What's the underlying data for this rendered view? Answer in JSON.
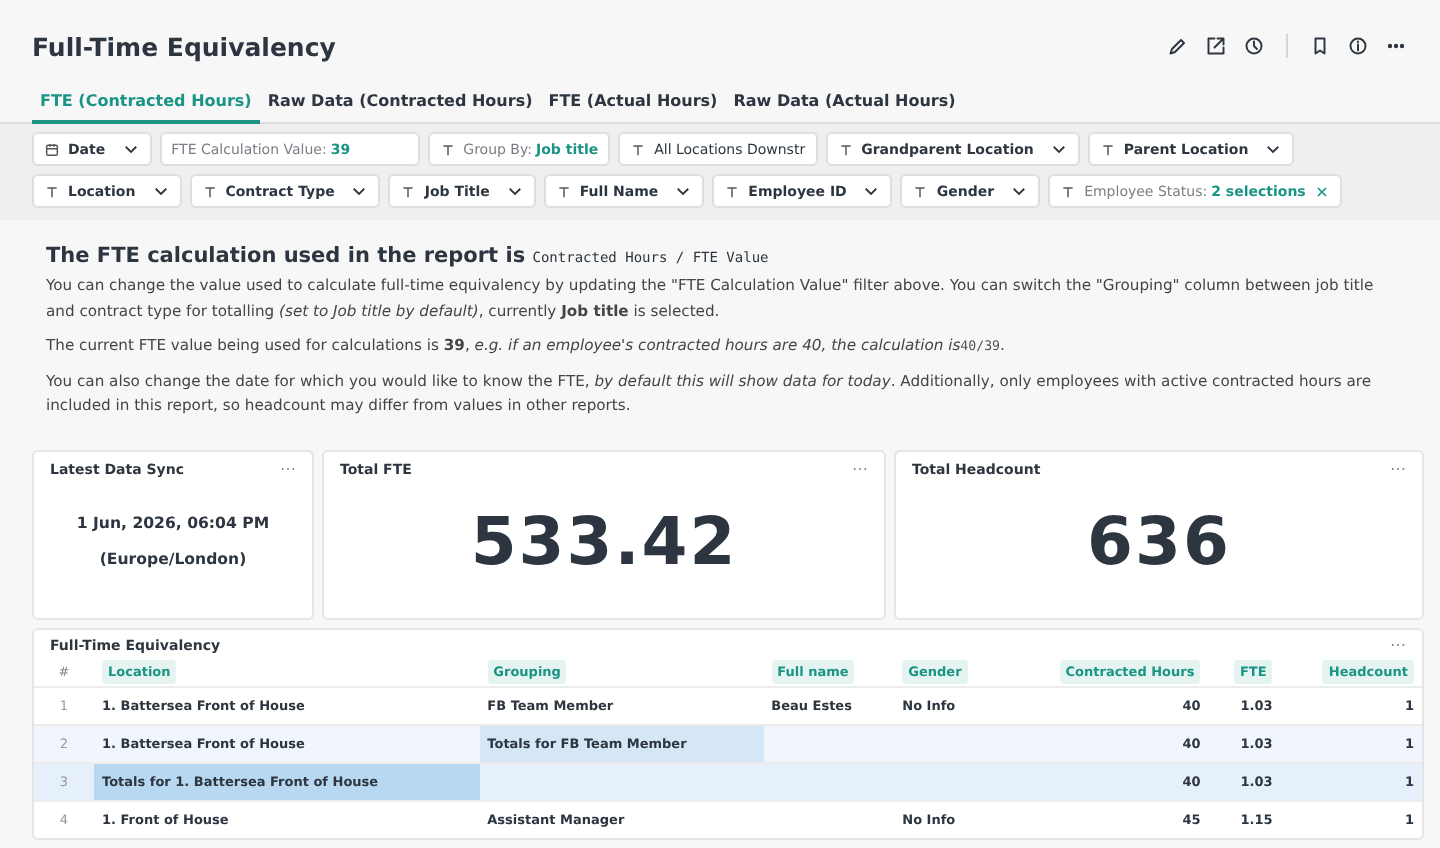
{
  "title": "Full-Time Equivalency",
  "tabs": [
    {
      "label": "FTE (Contracted Hours)",
      "selected": true
    },
    {
      "label": "Raw Data (Contracted Hours)",
      "selected": false
    },
    {
      "label": "FTE (Actual Hours)",
      "selected": false
    },
    {
      "label": "Raw Data (Actual Hours)",
      "selected": false
    }
  ],
  "filter_rows": [
    [
      {
        "kind": "date",
        "label": "Date"
      },
      {
        "kind": "number",
        "label": "FTE Calculation Value:",
        "value": "39"
      },
      {
        "kind": "value",
        "label": "Group By:",
        "value": "Job title"
      },
      {
        "kind": "input",
        "value": "All Locations Downstr"
      },
      {
        "kind": "select",
        "label": "Grandparent Location"
      },
      {
        "kind": "select",
        "label": "Parent Location"
      }
    ],
    [
      {
        "kind": "select",
        "label": "Location"
      },
      {
        "kind": "select",
        "label": "Contract Type"
      },
      {
        "kind": "select",
        "label": "Job Title"
      },
      {
        "kind": "select",
        "label": "Full Name"
      },
      {
        "kind": "select",
        "label": "Employee ID"
      },
      {
        "kind": "select",
        "label": "Gender"
      },
      {
        "kind": "value",
        "label": "Employee Status:",
        "value": "2 selections",
        "clearable": true
      }
    ]
  ],
  "intro": {
    "heading": "The FTE calculation used in the report is",
    "formula": "Contracted Hours / FTE Value",
    "paragraphs": [
      {
        "before": "You can change the value used to calculate full-time equivalency by updating the \"FTE Calculation Value\" filter above. You can switch the \"Grouping\" column between job title and contract type for totalling *(set to Job title by default)*, currently **Job title** is selected."
      },
      {
        "before": "The current FTE value being used for calculations is **39**, *e.g. if an employee's contracted hours are 40, the calculation is*",
        "code": "40/39",
        "after": "."
      },
      {
        "before": "You can also change the date for which you would like to know the FTE, *by default this will show data for today*. Additionally, only employees with active contracted hours are included in this report, so headcount may differ from values in other reports."
      }
    ]
  },
  "cards": [
    {
      "kind": "text",
      "title": "Latest Data Sync",
      "lines": [
        "1 Jun, 2026, 06:04 PM",
        "(Europe/London)"
      ]
    },
    {
      "kind": "number",
      "title": "Total FTE",
      "value": "533.42"
    },
    {
      "kind": "number",
      "title": "Total Headcount",
      "value": "636"
    }
  ],
  "table": {
    "title": "Full-Time Equivalency",
    "index_header": "#",
    "columns": [
      "Location",
      "Grouping",
      "Full name",
      "Gender",
      "Contracted Hours",
      "FTE",
      "Headcount"
    ],
    "rows": [
      {
        "index": "1",
        "kind": "detail",
        "cells": [
          "1. Battersea Front of House",
          "FB Team Member",
          "Beau Estes",
          "No Info",
          "40",
          "1.03",
          "1"
        ]
      },
      {
        "index": "2",
        "kind": "subtotal",
        "cells": [
          "1. Battersea Front of House",
          "Totals for FB Team Member",
          "",
          "",
          "40",
          "1.03",
          "1"
        ]
      },
      {
        "index": "3",
        "kind": "total",
        "cells": [
          "Totals for 1. Battersea Front of House",
          "",
          "",
          "",
          "40",
          "1.03",
          "1"
        ]
      },
      {
        "index": "4",
        "kind": "detail",
        "cells": [
          "1. Front of House",
          "Assistant Manager",
          "",
          "No Info",
          "45",
          "1.15",
          "1"
        ]
      }
    ]
  }
}
